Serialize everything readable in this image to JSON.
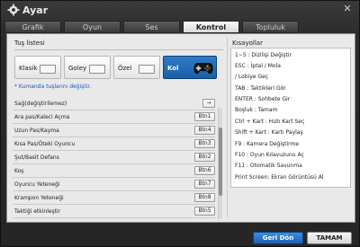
{
  "window": {
    "title": "Ayar"
  },
  "tabs": [
    {
      "label": "Grafik"
    },
    {
      "label": "Oyun"
    },
    {
      "label": "Ses"
    },
    {
      "label": "Kontrol",
      "active": true
    },
    {
      "label": "Topluluk"
    }
  ],
  "left": {
    "section_title": "Tuş listesi",
    "presets": [
      {
        "label": "Klasik"
      },
      {
        "label": "Goley"
      },
      {
        "label": "Özel"
      },
      {
        "label": "Kol",
        "active": true
      }
    ],
    "note": "* Kumanda tuşlarını değiştir.",
    "rows": [
      {
        "name": "Sağ(değiştirilemez)",
        "key": "→"
      },
      {
        "name": "Ara pas/Kaleci Açma",
        "key": "Btn1"
      },
      {
        "name": "Uzun Pas/Kayma",
        "key": "Btn4"
      },
      {
        "name": "Kısa Pas/Öteki Oyuncu",
        "key": "Btn3"
      },
      {
        "name": "Şut/Basit Defans",
        "key": "Btn2"
      },
      {
        "name": "Koş",
        "key": "Btn6"
      },
      {
        "name": "Oyuncu Yeteneği",
        "key": "Btn7"
      },
      {
        "name": "Krampon Yeteneği",
        "key": "Btn8"
      },
      {
        "name": "Taktiği etkinleştir",
        "key": "Btn5"
      }
    ]
  },
  "right": {
    "section_title": "Kısayollar",
    "lines": [
      "1~5 :  Dizilişi Değiştir",
      "ESC :  İptal  / Mola",
      "          / Lobiye Geç",
      "TAB :  Taktikleri Gör",
      "ENTER :  Sohbete Gir",
      "Boşluk :  Tamam",
      "Ctrl + Kart :  Hızlı Kart Seç",
      "Shift + Kart :  Kartı Paylaş",
      "F9 :  Kamera Değiştirme",
      "F10 :  Oyun Kılavuzunu Aç",
      "F11 :  Otomatik Savunma",
      "Print Screen:  Ekran Görüntüsü Al"
    ]
  },
  "footer": {
    "back": "Geri Dön",
    "ok": "TAMAM"
  },
  "icons": {
    "settings": "gear-icon",
    "close": "close-icon",
    "keyboard": "keyboard-icon",
    "gamepad": "gamepad-icon"
  }
}
